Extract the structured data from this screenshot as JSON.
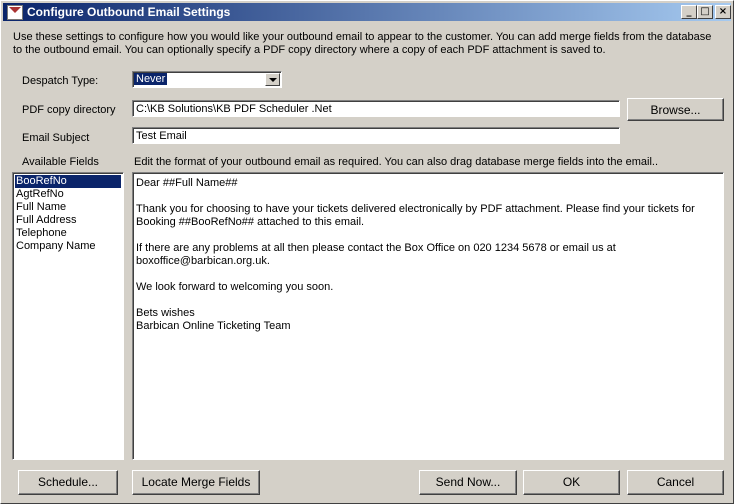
{
  "window": {
    "title": "Configure Outbound Email Settings",
    "minimize": "_",
    "maximize": "□",
    "close": "×"
  },
  "intro": "Use these settings to configure how you would like your outbound email  to appear to the customer.  You can add merge fields from the database to the outbound email.  You can optionally specify a PDF copy directory where  a copy of each PDF attachment is saved to.",
  "despatch": {
    "label": "Despatch Type:",
    "value": "Never"
  },
  "pdf_dir": {
    "label": "PDF copy directory",
    "value": "C:\\KB Solutions\\KB PDF Scheduler .Net",
    "browse": "Browse..."
  },
  "subject": {
    "label": "Email Subject",
    "value": "Test Email"
  },
  "fields": {
    "label": "Available Fields",
    "items": [
      "BooRefNo",
      "AgtRefNo",
      "Full Name",
      "Full Address",
      "Telephone",
      "Company Name"
    ]
  },
  "editor": {
    "instructions": "Edit the format of your outbound email as required.  You can also drag database merge fields into the email..",
    "lines": [
      "Dear ##Full Name##",
      "",
      "Thank you for choosing to have your tickets delivered electronically by PDF attachment.  Please find your tickets for",
      "Booking ##BooRefNo## attached to this email.",
      "",
      "If there are any problems at all then please contact the Box Office on 020 1234 5678 or email us at",
      "boxoffice@barbican.org.uk.",
      "",
      "We look forward to welcoming you soon.",
      "",
      "Bets wishes",
      "Barbican Online Ticketing Team"
    ]
  },
  "buttons": {
    "schedule": "Schedule...",
    "locate": "Locate Merge Fields",
    "send_now": "Send Now...",
    "ok": "OK",
    "cancel": "Cancel"
  }
}
